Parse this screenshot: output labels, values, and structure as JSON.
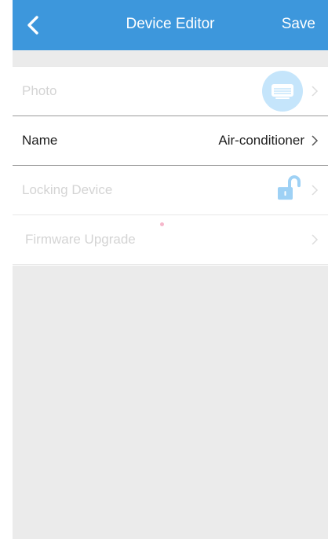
{
  "navbar": {
    "title": "Device Editor",
    "save_label": "Save",
    "back_icon": "chevron-left-icon",
    "color": "#3d97dc"
  },
  "rows": [
    {
      "label": "Photo",
      "icon": "air-conditioner-icon"
    },
    {
      "label": "Name",
      "value": "Air-conditioner"
    },
    {
      "label": "Locking Device",
      "icon": "unlocked-padlock-icon"
    },
    {
      "label": "Firmware Upgrade"
    }
  ],
  "colors": {
    "accent": "#3d97dc",
    "photo_bg": "#c5e5fb",
    "disabled_text": "#d4d4d4",
    "background": "#ebebeb"
  }
}
